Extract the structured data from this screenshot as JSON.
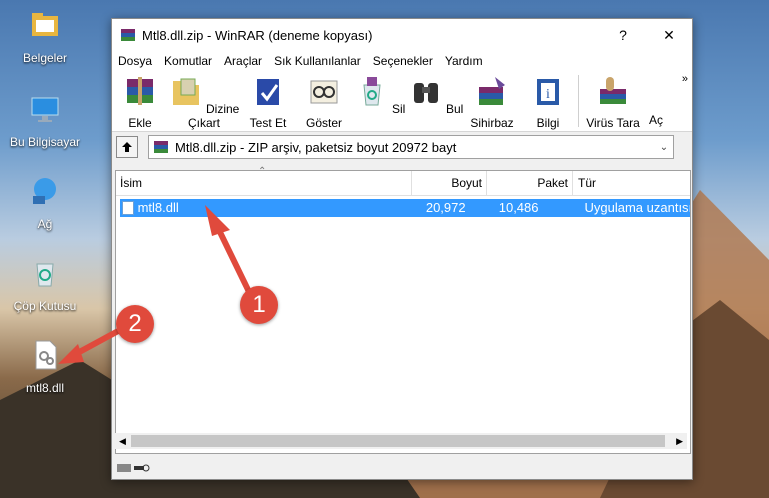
{
  "desktop": {
    "icons": [
      {
        "label": "Belgeler"
      },
      {
        "label": "Bu Bilgisayar"
      },
      {
        "label": "Ağ"
      },
      {
        "label": "Çöp Kutusu"
      },
      {
        "label": "mtl8.dll"
      }
    ]
  },
  "window": {
    "title": "Mtl8.dll.zip - WinRAR (deneme kopyası)",
    "help_btn": "?",
    "close_btn": "✕",
    "menu": [
      "Dosya",
      "Komutlar",
      "Araçlar",
      "Sık Kullanılanlar",
      "Seçenekler",
      "Yardım"
    ],
    "toolbar": [
      {
        "label": "Ekle",
        "icon": "add-icon"
      },
      {
        "label": "Dizine Çıkart",
        "icon": "extract-icon"
      },
      {
        "label": "Test Et",
        "icon": "test-icon"
      },
      {
        "label": "Göster",
        "icon": "view-icon"
      },
      {
        "label": "Sil",
        "icon": "delete-icon"
      },
      {
        "label": "Bul",
        "icon": "find-icon"
      },
      {
        "label": "Sihirbaz",
        "icon": "wizard-icon"
      },
      {
        "label": "Bilgi",
        "icon": "info-icon"
      },
      {
        "label": "Virüs Tara",
        "icon": "virus-scan-icon"
      },
      {
        "label": "Aç",
        "icon": "open-icon"
      }
    ],
    "toolbar_more": "»",
    "path": "Mtl8.dll.zip - ZIP arşiv, paketsiz boyut 20972 bayt",
    "columns": [
      "İsim",
      "Boyut",
      "Paket",
      "Tür"
    ],
    "rows": [
      {
        "name": "mtl8.dll",
        "size": "20,972",
        "packed": "10,486",
        "type": "Uygulama uzantısı"
      }
    ]
  },
  "annotations": [
    {
      "number": "1"
    },
    {
      "number": "2"
    }
  ],
  "colors": {
    "selection": "#3399ff",
    "badge": "#e04a3c"
  }
}
